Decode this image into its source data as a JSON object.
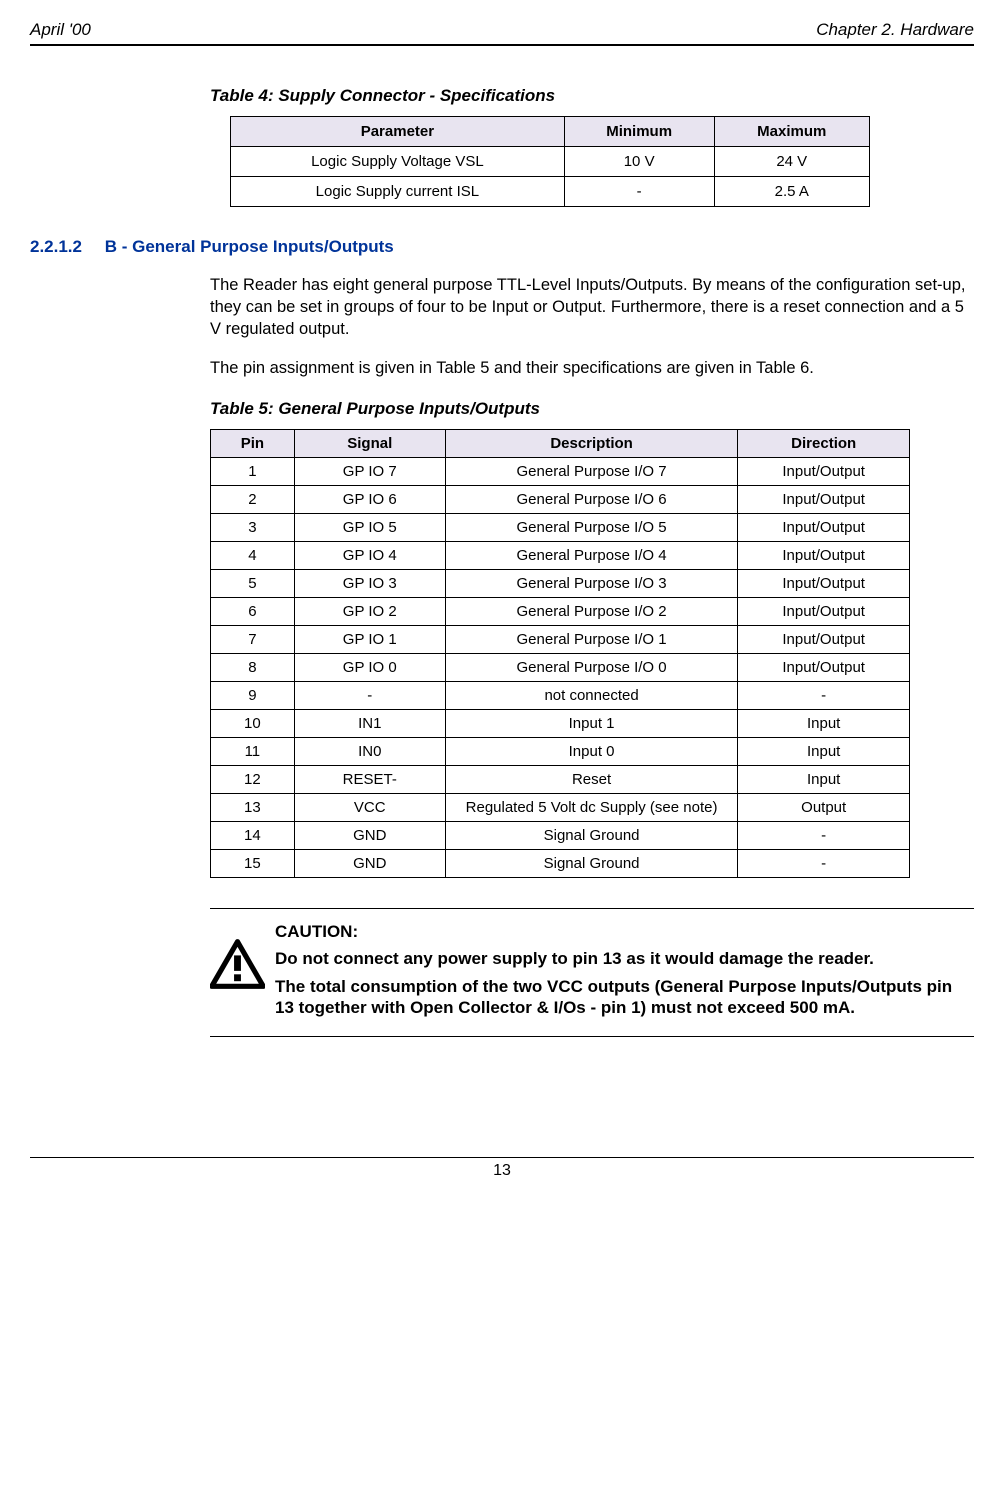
{
  "header": {
    "left": "April '00",
    "right": "Chapter 2. Hardware"
  },
  "table4": {
    "caption": "Table 4: Supply Connector - Specifications",
    "headers": [
      "Parameter",
      "Minimum",
      "Maximum"
    ],
    "rows": [
      [
        "Logic Supply Voltage VSL",
        "10 V",
        "24 V"
      ],
      [
        "Logic Supply current ISL",
        "-",
        "2.5 A"
      ]
    ]
  },
  "section": {
    "num": "2.2.1.2",
    "title": "B - General Purpose Inputs/Outputs",
    "para1": "The Reader has eight general purpose TTL-Level Inputs/Outputs. By means of the configuration set-up, they can be set in groups of four to be Input or Output. Furthermore, there is a reset connection and a 5 V regulated output.",
    "para2": "The pin assignment is given in Table 5 and their specifications are given in Table 6."
  },
  "table5": {
    "caption": "Table 5: General Purpose Inputs/Outputs",
    "headers": [
      "Pin",
      "Signal",
      "Description",
      "Direction"
    ],
    "rows": [
      [
        "1",
        "GP IO 7",
        "General Purpose I/O 7",
        "Input/Output"
      ],
      [
        "2",
        "GP IO 6",
        "General Purpose I/O 6",
        "Input/Output"
      ],
      [
        "3",
        "GP IO 5",
        "General Purpose I/O 5",
        "Input/Output"
      ],
      [
        "4",
        "GP IO 4",
        "General Purpose I/O 4",
        "Input/Output"
      ],
      [
        "5",
        "GP IO 3",
        "General Purpose I/O 3",
        "Input/Output"
      ],
      [
        "6",
        "GP IO 2",
        "General Purpose I/O 2",
        "Input/Output"
      ],
      [
        "7",
        "GP IO 1",
        "General Purpose I/O 1",
        "Input/Output"
      ],
      [
        "8",
        "GP IO 0",
        "General Purpose I/O 0",
        "Input/Output"
      ],
      [
        "9",
        "-",
        "not connected",
        "-"
      ],
      [
        "10",
        "IN1",
        "Input 1",
        "Input"
      ],
      [
        "11",
        "IN0",
        "Input 0",
        "Input"
      ],
      [
        "12",
        "RESET-",
        "Reset",
        "Input"
      ],
      [
        "13",
        "VCC",
        "Regulated 5 Volt dc Supply (see note)",
        "Output"
      ],
      [
        "14",
        "GND",
        "Signal Ground",
        "-"
      ],
      [
        "15",
        "GND",
        "Signal Ground",
        "-"
      ]
    ]
  },
  "caution": {
    "title": "CAUTION:",
    "line1": "Do not connect any power supply to pin 13 as it would damage the reader.",
    "line2": "The total consumption of the two VCC outputs (General Purpose Inputs/Outputs pin 13 together with Open Collector & I/Os - pin 1) must not exceed 500 mA."
  },
  "footer": {
    "page": "13"
  }
}
